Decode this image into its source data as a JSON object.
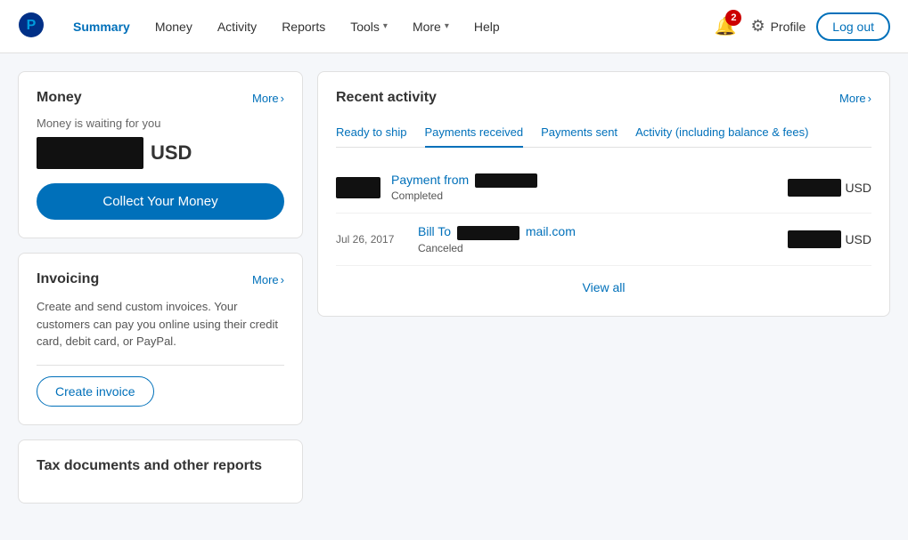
{
  "header": {
    "logo_alt": "PayPal",
    "nav": [
      {
        "id": "summary",
        "label": "Summary",
        "active": true
      },
      {
        "id": "money",
        "label": "Money",
        "active": false
      },
      {
        "id": "activity",
        "label": "Activity",
        "active": false
      },
      {
        "id": "reports",
        "label": "Reports",
        "active": false
      },
      {
        "id": "tools",
        "label": "Tools",
        "has_arrow": true
      },
      {
        "id": "more",
        "label": "More",
        "has_arrow": true
      },
      {
        "id": "help",
        "label": "Help",
        "active": false
      }
    ],
    "notifications_count": "2",
    "profile_label": "Profile",
    "logout_label": "Log out"
  },
  "money_card": {
    "title": "Money",
    "more_label": "More",
    "waiting_text": "Money is waiting for you",
    "currency": "USD",
    "collect_button": "Collect Your Money"
  },
  "invoicing_card": {
    "title": "Invoicing",
    "more_label": "More",
    "description": "Create and send custom invoices. Your customers can pay you online using their credit card, debit card, or PayPal.",
    "create_button": "Create invoice"
  },
  "tax_card": {
    "title": "Tax documents and other reports"
  },
  "recent_activity": {
    "title": "Recent activity",
    "more_label": "More",
    "tabs": [
      {
        "id": "ready_to_ship",
        "label": "Ready to ship"
      },
      {
        "id": "payments_received",
        "label": "Payments received"
      },
      {
        "id": "payments_sent",
        "label": "Payments sent"
      },
      {
        "id": "activity_balance",
        "label": "Activity (including balance & fees)"
      }
    ],
    "transactions": [
      {
        "id": "tx1",
        "date": "",
        "label_prefix": "Payment from",
        "status": "Completed",
        "currency": "USD"
      },
      {
        "id": "tx2",
        "date": "Jul 26, 2017",
        "label_prefix": "Bill To",
        "email_suffix": "mail.com",
        "status": "Canceled",
        "currency": "USD"
      }
    ],
    "view_all_label": "View all"
  }
}
